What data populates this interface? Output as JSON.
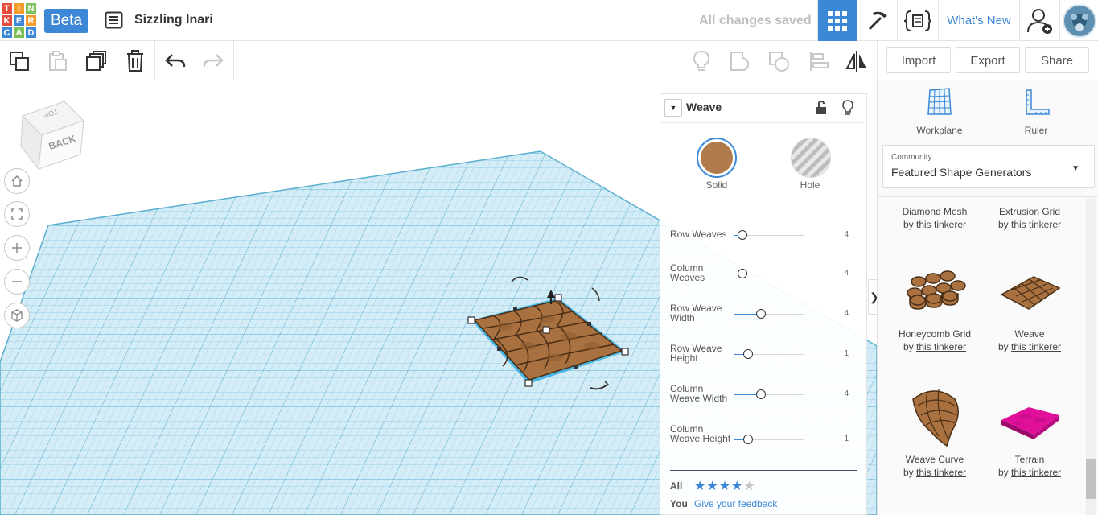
{
  "logo": {
    "letters": [
      "T",
      "I",
      "N",
      "K",
      "E",
      "R",
      "C",
      "A",
      "D"
    ],
    "colors": [
      "#e64b3b",
      "#f39c2d",
      "#7dc15a",
      "#e64b3b",
      "#3c87d6",
      "#f39c2d",
      "#3c87d6",
      "#7dc15a",
      "#3c87d6"
    ]
  },
  "header": {
    "beta_label": "Beta",
    "design_name": "Sizzling Inari",
    "save_status": "All changes saved",
    "whats_new": "What's New"
  },
  "toolbar": {
    "import": "Import",
    "export": "Export",
    "share": "Share"
  },
  "viewcube": {
    "front": "BACK",
    "top": "TOP"
  },
  "inspector": {
    "title": "Weave",
    "solid_label": "Solid",
    "hole_label": "Hole",
    "solid_color": "#b07a4a",
    "params": [
      {
        "label": "Row Weaves",
        "value": "4",
        "fraction": 0.12
      },
      {
        "label": "Column Weaves",
        "value": "4",
        "fraction": 0.12
      },
      {
        "label": "Row Weave Width",
        "value": "4",
        "fraction": 0.38
      },
      {
        "label": "Row Weave Height",
        "value": "1",
        "fraction": 0.2
      },
      {
        "label": "Column Weave Width",
        "value": "4",
        "fraction": 0.38
      },
      {
        "label": "Column Weave Height",
        "value": "1",
        "fraction": 0.2
      }
    ],
    "rating_all_label": "All",
    "rating_all_stars": 4,
    "rating_you_label": "You",
    "feedback_link": "Give your feedback"
  },
  "rightpanel": {
    "workplane_label": "Workplane",
    "ruler_label": "Ruler",
    "category_small": "Community",
    "category_main": "Featured Shape Generators",
    "shapes": [
      {
        "name": "Diamond Mesh",
        "by": "by",
        "author": "this tinkerer"
      },
      {
        "name": "Extrusion Grid",
        "by": "by",
        "author": "this tinkerer"
      },
      {
        "name": "Honeycomb Grid",
        "by": "by",
        "author": "this tinkerer"
      },
      {
        "name": "Weave",
        "by": "by",
        "author": "this tinkerer"
      },
      {
        "name": "Weave Curve",
        "by": "by",
        "author": "this tinkerer"
      },
      {
        "name": "Terrain",
        "by": "by",
        "author": "this tinkerer"
      }
    ]
  }
}
